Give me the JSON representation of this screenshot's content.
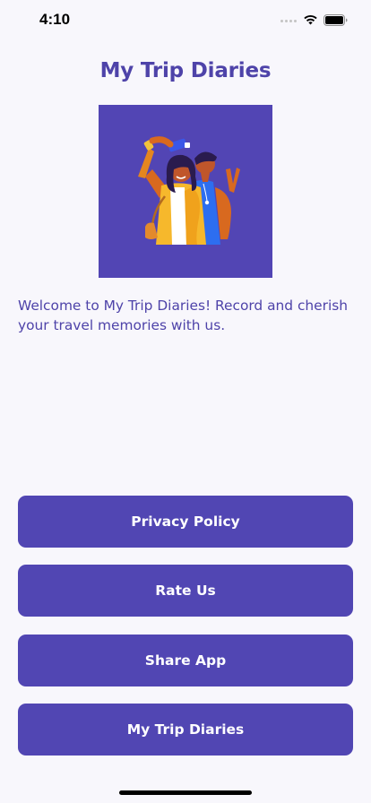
{
  "status_bar": {
    "time": "4:10",
    "icons": [
      "signal-dots-icon",
      "wifi-icon",
      "battery-icon"
    ]
  },
  "app": {
    "title": "My Trip Diaries",
    "hero_image": "friends-taking-selfie-illustration",
    "welcome_text": "Welcome to My Trip Diaries! Record and cherish your travel memories with us."
  },
  "actions": {
    "privacy_label": "Privacy Policy",
    "rate_label": "Rate Us",
    "share_label": "Share App",
    "more_label": "My Trip Diaries"
  },
  "colors": {
    "accent": "#5146b3",
    "title": "#4e43a9",
    "background": "#f8f7fc",
    "button_text": "#ffffff"
  }
}
